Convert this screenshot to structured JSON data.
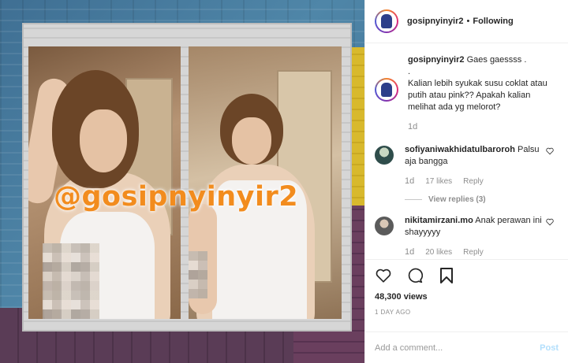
{
  "header": {
    "username": "gosipnyinyir2",
    "separator": "•",
    "follow_status": "Following"
  },
  "media": {
    "watermark": "@gosipnyinyir2"
  },
  "caption": {
    "username": "gosipnyinyir2",
    "line1": "Gaes gaessss .",
    "line2": ".",
    "line3": "Kalian lebih syukak susu coklat atau putih atau pink?? Apakah kalian melihat ada yg melorot?",
    "time": "1d"
  },
  "comments": [
    {
      "username": "sofiyaniwakhidatulbaroroh",
      "text": "Palsu aja bangga",
      "time": "1d",
      "likes": "17 likes",
      "reply": "Reply",
      "view_replies": "View replies (3)"
    },
    {
      "username": "nikitamirzani.mo",
      "text": "Anak perawan ini shayyyyy",
      "time": "1d",
      "likes": "20 likes",
      "reply": "Reply"
    }
  ],
  "stats": {
    "views": "48,300 views",
    "ago": "1 DAY AGO"
  },
  "composer": {
    "placeholder": "Add a comment...",
    "post_label": "Post"
  },
  "icons": {
    "like": "heart-icon",
    "comment": "comment-icon",
    "save": "bookmark-icon"
  }
}
